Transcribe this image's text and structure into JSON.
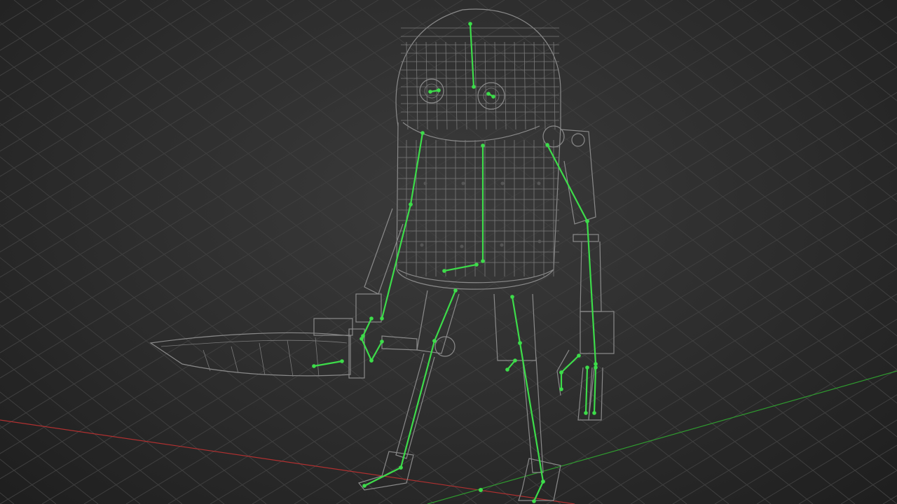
{
  "viewport": {
    "background": "#2c2c2c",
    "grid_color": "#3f3f3f",
    "x_axis_color": "#b03030",
    "y_axis_color": "#2f9a2f",
    "wireframe_color": "#8a8a8a",
    "bone_color": "#3ddc4a"
  },
  "model": {
    "icon": "robot-wireframe-icon",
    "bones_icon": "skeleton-rig-icon"
  }
}
